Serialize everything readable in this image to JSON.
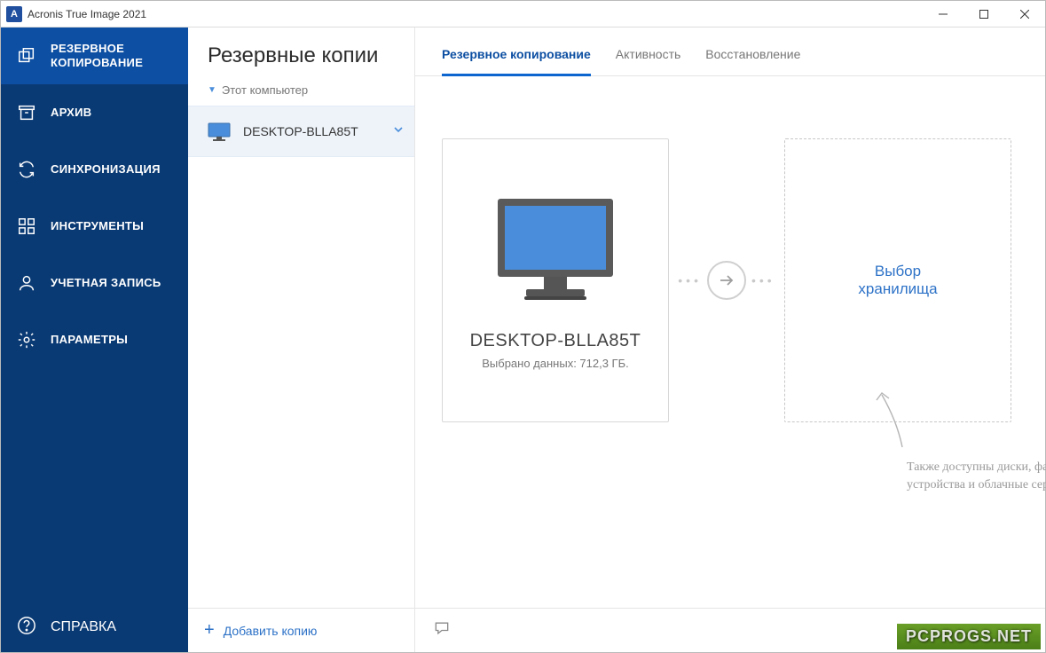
{
  "window": {
    "title": "Acronis True Image 2021"
  },
  "sidebar": {
    "items": [
      {
        "label": "РЕЗЕРВНОЕ КОПИРОВАНИЕ"
      },
      {
        "label": "АРХИВ"
      },
      {
        "label": "СИНХРОНИЗАЦИЯ"
      },
      {
        "label": "ИНСТРУМЕНТЫ"
      },
      {
        "label": "УЧЕТНАЯ ЗАПИСЬ"
      },
      {
        "label": "ПАРАМЕТРЫ"
      }
    ],
    "help_label": "СПРАВКА"
  },
  "list_panel": {
    "title": "Резервные копии",
    "group_label": "Этот компьютер",
    "item_name": "DESKTOP-BLLA85T",
    "add_label": "Добавить копию"
  },
  "tabs": [
    {
      "label": "Резервное копирование"
    },
    {
      "label": "Активность"
    },
    {
      "label": "Восстановление"
    }
  ],
  "source_card": {
    "name": "DESKTOP-BLLA85T",
    "subtitle": "Выбрано данных: 712,3 ГБ."
  },
  "dest_card": {
    "line1": "Выбор",
    "line2": "хранилища"
  },
  "hint_text": "Также доступны диски, файлы, мобильные устройства и облачные сервисы",
  "watermark": "PCPROGS.NET"
}
